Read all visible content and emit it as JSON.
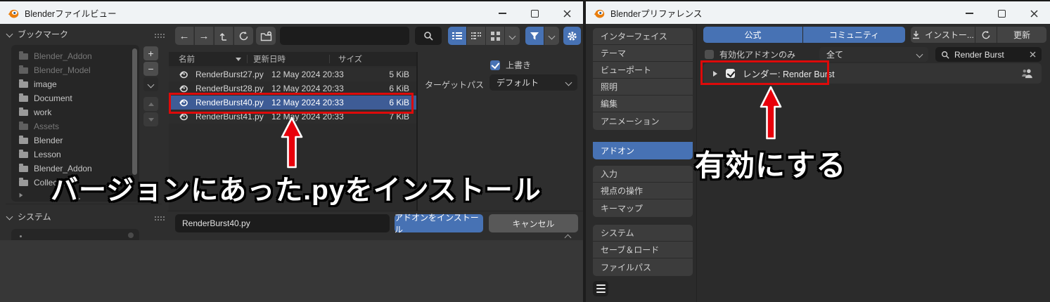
{
  "colors": {
    "accent_blue": "#4772b4",
    "annotation_red": "#dd0a0a",
    "titlebar_bg": "#f0f3f5",
    "selected_row_blue": "#3e5c96"
  },
  "left_window": {
    "title": "Blenderファイルビュー",
    "sidebar": {
      "bookmarks_header": "ブックマーク",
      "system_header": "システム",
      "items": [
        {
          "label": "Blender_Addon",
          "dim": true
        },
        {
          "label": "Blender_Model",
          "dim": true
        },
        {
          "label": "image",
          "dim": false
        },
        {
          "label": "Document",
          "dim": false
        },
        {
          "label": "work",
          "dim": false
        },
        {
          "label": "Assets",
          "dim": true
        },
        {
          "label": "Blender",
          "dim": false
        },
        {
          "label": "Lesson",
          "dim": false
        },
        {
          "label": "Blender_Addon",
          "dim": false
        },
        {
          "label": "Collection",
          "dim": false
        }
      ]
    },
    "files": {
      "col_name": "名前",
      "col_date": "更新日時",
      "col_size": "サイズ",
      "rows": [
        {
          "name": "RenderBurst27.py",
          "date": "12 May 2024 20:33",
          "size": "5 KiB"
        },
        {
          "name": "RenderBurst28.py",
          "date": "12 May 2024 20:33",
          "size": "6 KiB"
        },
        {
          "name": "RenderBurst40.py",
          "date": "12 May 2024 20:33",
          "size": "6 KiB"
        },
        {
          "name": "RenderBurst41.py",
          "date": "12 May 2024 20:33",
          "size": "7 KiB"
        }
      ]
    },
    "options": {
      "overwrite_label": "上書き",
      "target_path_label": "ターゲットパス",
      "target_path_value": "デフォルト"
    },
    "footer": {
      "filename": "RenderBurst40.py",
      "install_label": "アドオンをインストール",
      "cancel_label": "キャンセル"
    }
  },
  "right_window": {
    "title": "Blenderプリファレンス",
    "sidebar": {
      "items": [
        {
          "label": "インターフェイス"
        },
        {
          "label": "テーマ"
        },
        {
          "label": "ビューポート"
        },
        {
          "label": "照明"
        },
        {
          "label": "編集"
        },
        {
          "label": "アニメーション"
        },
        {
          "label": "アドオン"
        },
        {
          "label": "入力"
        },
        {
          "label": "視点の操作"
        },
        {
          "label": "キーマップ"
        },
        {
          "label": "システム"
        },
        {
          "label": "セーブ＆ロード"
        },
        {
          "label": "ファイルパス"
        }
      ],
      "active": "アドオン"
    },
    "tabs": {
      "official": "公式",
      "community": "コミュニティ"
    },
    "toolbar": {
      "install_label": "インストー...",
      "update_label": "更新"
    },
    "filters": {
      "enabled_only_label": "有効化アドオンのみ",
      "category_value": "全て",
      "search_value": "Render Burst"
    },
    "addon_row": {
      "label": "レンダー: Render Burst",
      "enabled": true
    }
  },
  "annotations": {
    "install_text": "バージョンにあった.pyをインストール",
    "enable_text": "有効にする"
  }
}
